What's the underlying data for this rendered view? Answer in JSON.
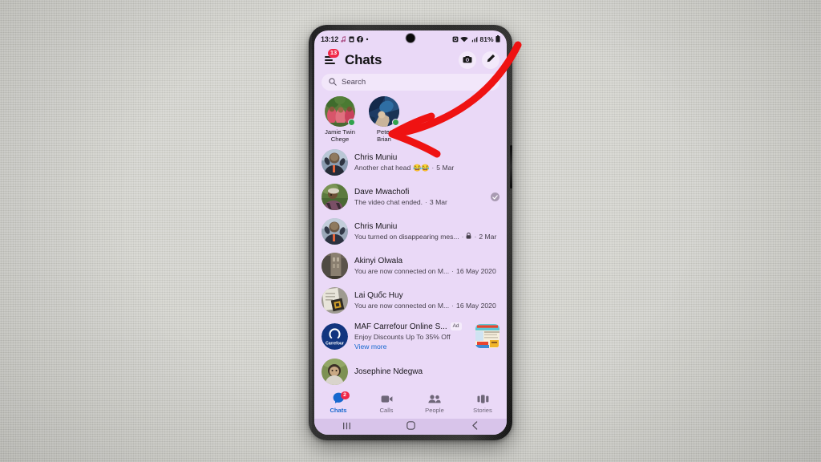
{
  "device": {
    "platform": "Android (Samsung)",
    "screen_background": "#ead9f7"
  },
  "status_bar": {
    "time": "13:12",
    "left_icons": [
      "music-note-icon",
      "sim-card-icon",
      "facebook-icon",
      "more-dot-icon"
    ],
    "right_icons": [
      "alarm-icon",
      "wifi-icon",
      "cellular-signal-icon",
      "battery-icon"
    ],
    "battery_percent": "81%"
  },
  "header": {
    "menu_icon": "hamburger-menu-icon",
    "menu_badge": "13",
    "title": "Chats",
    "camera_icon": "camera-icon",
    "compose_icon": "pencil-compose-icon"
  },
  "search": {
    "icon": "search-icon",
    "placeholder": "Search",
    "value": ""
  },
  "active_now": [
    {
      "name_line1": "Jamie Twin",
      "name_line2": "Chege",
      "online": true
    },
    {
      "name_line1": "Peter",
      "name_line2": "Brian",
      "online": true
    }
  ],
  "chats": [
    {
      "name": "Chris Muniu",
      "snippet": "Another chat head",
      "emoji": "😂😂",
      "time": "5 Mar",
      "lock": false,
      "seen": false,
      "sponsored": false
    },
    {
      "name": "Dave Mwachofi",
      "snippet": "The video chat ended.",
      "emoji": "",
      "time": "3 Mar",
      "lock": false,
      "seen": true,
      "sponsored": false
    },
    {
      "name": "Chris Muniu",
      "snippet": "You turned on disappearing mes...",
      "emoji": "",
      "time": "2 Mar",
      "lock": true,
      "seen": false,
      "sponsored": false
    },
    {
      "name": "Akinyi Olwala",
      "snippet": "You are now connected on M...",
      "emoji": "",
      "time": "16 May 2020",
      "lock": false,
      "seen": false,
      "sponsored": false
    },
    {
      "name": "Lai Quốc Huy",
      "snippet": "You are now connected on M...",
      "emoji": "",
      "time": "16 May 2020",
      "lock": false,
      "seen": false,
      "sponsored": false
    },
    {
      "name": "MAF Carrefour Online S...",
      "snippet": "Enjoy Discounts Up To 35% Off",
      "emoji": "",
      "time": "",
      "lock": false,
      "seen": false,
      "sponsored": true,
      "ad_tag": "Ad",
      "cta": "View more",
      "avatar_label": "Carrefour"
    },
    {
      "name": "Josephine Ndegwa",
      "snippet": "",
      "emoji": "",
      "time": "",
      "lock": false,
      "seen": false,
      "sponsored": false
    }
  ],
  "bottom_nav": [
    {
      "label": "Chats",
      "icon": "chat-bubble-icon",
      "active": true,
      "badge": "2"
    },
    {
      "label": "Calls",
      "icon": "video-camera-icon",
      "active": false,
      "badge": ""
    },
    {
      "label": "People",
      "icon": "people-icon",
      "active": false,
      "badge": ""
    },
    {
      "label": "Stories",
      "icon": "stories-icon",
      "active": false,
      "badge": ""
    }
  ],
  "android_nav": [
    {
      "icon": "recents-icon"
    },
    {
      "icon": "home-icon"
    },
    {
      "icon": "back-icon"
    }
  ],
  "annotation": {
    "type": "arrow",
    "color": "#ef1212",
    "points_to": "Peter Brian active-now avatar"
  }
}
